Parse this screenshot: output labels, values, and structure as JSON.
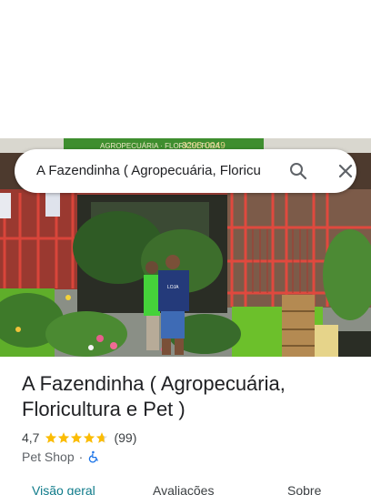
{
  "search": {
    "query": "A Fazendinha ( Agropecuária, Floricu"
  },
  "hero_photo": {
    "sign_text": "AGROPECUÁRIA · FLORICULTURA",
    "sign_phone": "3295-0049",
    "shirt_text": "LOJA"
  },
  "place": {
    "name": "A Fazendinha ( Agropecuária, Floricultura e Pet )",
    "rating": "4,7",
    "rating_stars": 4.7,
    "reviews_count": "(99)",
    "category": "Pet Shop",
    "separator": "·"
  },
  "tabs": [
    {
      "label": "Visão geral"
    },
    {
      "label": "Avaliações"
    },
    {
      "label": "Sobre"
    }
  ],
  "colors": {
    "accent": "#0f7b8a",
    "star": "#fbbc04",
    "wheelchair": "#1a73e8",
    "wall_green": "#6cc02b",
    "frame_red": "#d9453a"
  }
}
